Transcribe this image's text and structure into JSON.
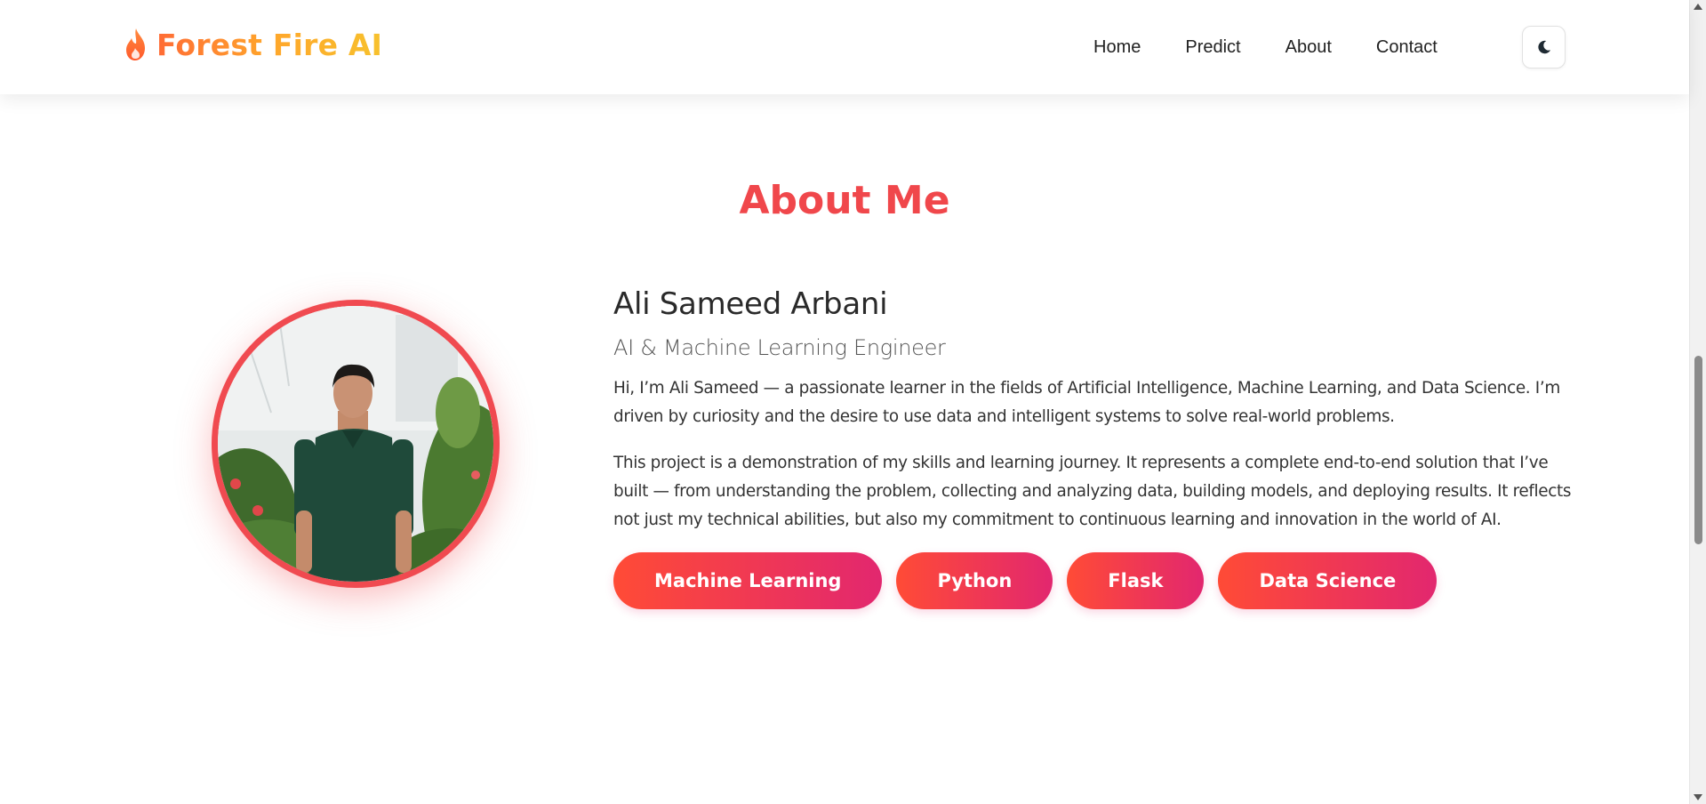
{
  "navbar": {
    "brand": "Forest Fire AI",
    "brand_icon": "flame-icon",
    "links": [
      {
        "label": "Home"
      },
      {
        "label": "Predict"
      },
      {
        "label": "About"
      },
      {
        "label": "Contact"
      }
    ],
    "theme_toggle_icon": "moon-icon"
  },
  "about": {
    "title": "About Me",
    "name": "Ali Sameed Arbani",
    "role": "AI & Machine Learning Engineer",
    "bio": [
      "Hi, I’m Ali Sameed — a passionate learner in the fields of Artificial Intelligence, Machine Learning, and Data Science. I’m driven by curiosity and the desire to use data and intelligent systems to solve real-world problems.",
      "This project is a demonstration of my skills and learning journey. It represents a complete end-to-end solution that I’ve built — from understanding the problem, collecting and analyzing data, building models, and deploying results. It reflects not just my technical abilities, but also my commitment to continuous learning and innovation in the world of AI."
    ],
    "skills": [
      "Machine Learning",
      "Python",
      "Flask",
      "Data Science"
    ]
  },
  "colors": {
    "accent": "#f0474b",
    "brand_gradient": [
      "#ff6b35",
      "#f7c12d"
    ],
    "skill_gradient": [
      "#ff4b36",
      "#e2276f"
    ]
  }
}
